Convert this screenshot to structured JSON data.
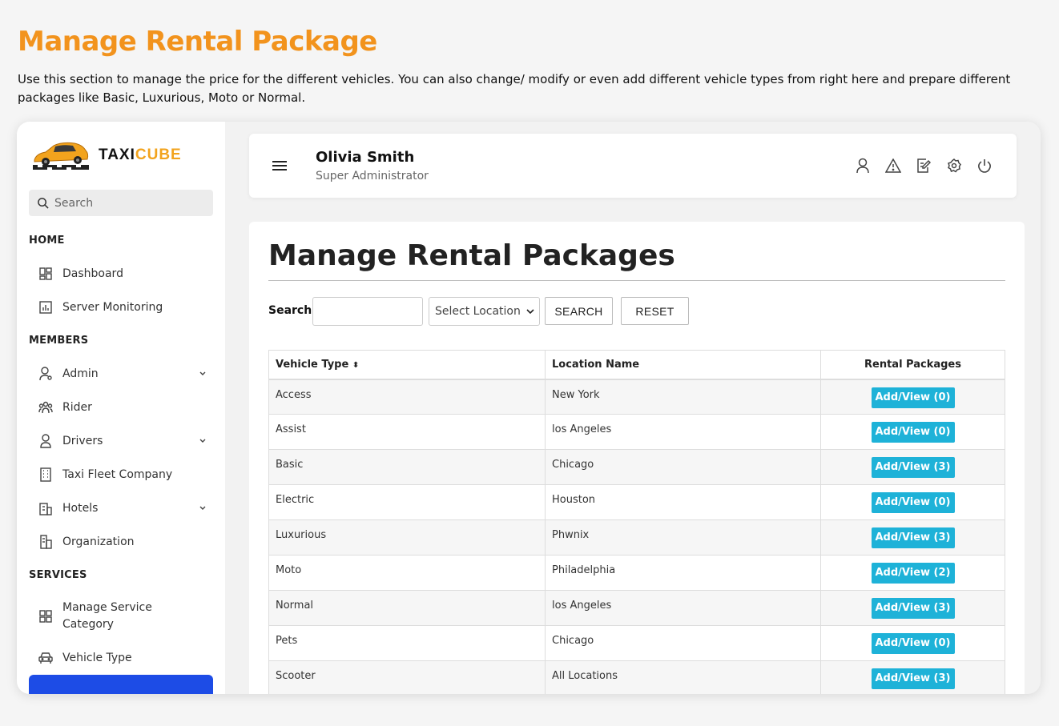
{
  "page": {
    "heading": "Manage Rental Package",
    "description": "Use this section to manage the price for the different vehicles. You can also change/ modify or even add different vehicle types from right here and prepare different packages like Basic, Luxurious, Moto or Normal."
  },
  "brand": {
    "name_part1": "TAXI",
    "name_part2": "CUBE",
    "accent": "#f2a31d"
  },
  "sidebar": {
    "search_placeholder": "Search",
    "sections": {
      "home": "HOME",
      "members": "MEMBERS",
      "services": "SERVICES"
    },
    "items": {
      "dashboard": "Dashboard",
      "server_monitoring": "Server Monitoring",
      "admin": "Admin",
      "rider": "Rider",
      "drivers": "Drivers",
      "taxi_fleet_company": "Taxi Fleet Company",
      "hotels": "Hotels",
      "organization": "Organization",
      "manage_service_category_1": "Manage Service",
      "manage_service_category_2": "Category",
      "vehicle_type": "Vehicle Type"
    }
  },
  "header": {
    "user_name": "Olivia Smith",
    "user_role": "Super Administrator",
    "icons": [
      "user-icon",
      "alert-icon",
      "edit-icon",
      "settings-icon",
      "power-icon"
    ]
  },
  "main": {
    "title": "Manage Rental Packages",
    "filter": {
      "search_label": "Search:",
      "search_value": "",
      "location_select": "Select Location",
      "search_button": "SEARCH",
      "reset_button": "RESET"
    },
    "table": {
      "columns": [
        "Vehicle Type",
        "Location Name",
        "Rental Packages"
      ],
      "sort_indicator": "⬍",
      "rows": [
        {
          "vehicle": "Access",
          "location": "New York",
          "packages": "Add/View (0)"
        },
        {
          "vehicle": "Assist",
          "location": "los Angeles",
          "packages": "Add/View (0)"
        },
        {
          "vehicle": "Basic",
          "location": "Chicago",
          "packages": "Add/View (3)"
        },
        {
          "vehicle": "Electric",
          "location": "Houston",
          "packages": "Add/View (0)"
        },
        {
          "vehicle": "Luxurious",
          "location": "Phwnix",
          "packages": "Add/View (3)"
        },
        {
          "vehicle": "Moto",
          "location": "Philadelphia",
          "packages": "Add/View (2)"
        },
        {
          "vehicle": "Normal",
          "location": "los Angeles",
          "packages": "Add/View (3)"
        },
        {
          "vehicle": "Pets",
          "location": "Chicago",
          "packages": "Add/View (0)"
        },
        {
          "vehicle": "Scooter",
          "location": "All Locations",
          "packages": "Add/View (3)"
        }
      ]
    }
  },
  "colors": {
    "heading_orange": "#f2931d",
    "active_nav": "#1d4ce6",
    "package_button": "#1eb2d8"
  }
}
